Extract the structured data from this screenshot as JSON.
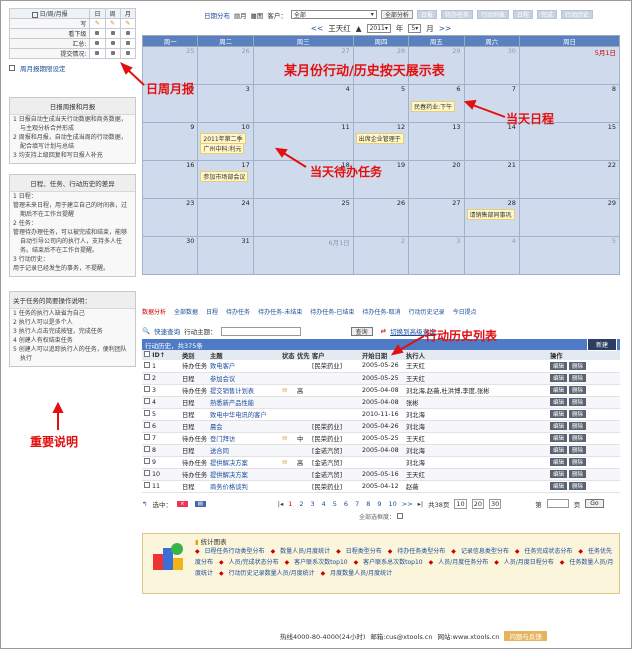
{
  "left_panel": {
    "grid_headers": [
      "日/周/月报",
      "日",
      "周",
      "月"
    ],
    "grid_rows": [
      "写",
      "看下级",
      "汇总:",
      "提交情况:"
    ],
    "setting_link": "周月报期限设定",
    "box1": {
      "title": "日报周报和月报",
      "items": [
        "1 日报自动生成当天行动数据和商务数据，与主观分析合并形成",
        "2 周报和月报，自动生成当周的行动数据，配合填写计划与总结",
        "3 均支持上级回复和写日报人补充"
      ]
    },
    "box2": {
      "title": "日程、任务、行动历史的差异",
      "items": [
        "1 日程：",
        "管理未来日程，用于建立自己的时间表，过期后不在工作台提醒",
        "2 任务：",
        "管理待办理任务，可以被完成和结束，能够自动引导公司内的执行人，支持多人任务。结束后不在工作台提醒。",
        "3 行动历史：",
        "用于记录已经发生的事务，不提醒。"
      ]
    },
    "box3": {
      "title": "关于任务的简要操作说明：",
      "items": [
        "1 任务的执行人缺省为自己",
        "2 执行人可以是多个人",
        "3 执行人点击完成按钮，完成任务",
        "4 创建人有权结束任务",
        "5 创建人可以追踪执行人的任务，便利团队执行"
      ]
    }
  },
  "top_toolbar": {
    "view_label": "日期分布",
    "view_month": "月",
    "view_grid": "图",
    "customer_label": "客户：",
    "customer_select": "全部",
    "btn_all": "全部分析",
    "btn_disabled": [
      "日报",
      "待办任务",
      "行动列表",
      "日程",
      "完成",
      "行动历史"
    ]
  },
  "calendar": {
    "prev": "<<",
    "owner": "王天红",
    "year": "2011",
    "year_suffix": "年",
    "month": "5",
    "month_suffix": "月",
    "next": ">>",
    "weekdays": [
      "周一",
      "周二",
      "周三",
      "周四",
      "周五",
      "周六",
      "周日"
    ],
    "weeks": [
      [
        "25",
        "26",
        "27",
        "28",
        "29",
        "30",
        "5月1日"
      ],
      [
        "2",
        "3",
        "4",
        "5",
        "6",
        "7",
        "8"
      ],
      [
        "9",
        "10",
        "11",
        "12",
        "13",
        "14",
        "15"
      ],
      [
        "16",
        "17",
        "18",
        "19",
        "20",
        "21",
        "22"
      ],
      [
        "23",
        "24",
        "25",
        "26",
        "27",
        "28",
        "29"
      ],
      [
        "30",
        "31",
        "6月1日",
        "2",
        "3",
        "4",
        "5"
      ]
    ],
    "events": {
      "e1": "民春药业:下午",
      "e2": "2011年第二季",
      "e3": "广州中科:利元",
      "e4": "出席企业管理于",
      "e5": "参加市场部会议",
      "e6": "请销售部同事巩"
    }
  },
  "annotations": {
    "a1": "某月份行动/历史按天展示表",
    "a2": "日周月报",
    "a3": "当天日程",
    "a4": "当天待办任务",
    "a5": "行动历史列表",
    "a6": "重要说明"
  },
  "tabs": [
    "数据分析",
    "全部数据",
    "日程",
    "待办任务",
    "待办任务-未结束",
    "待办任务-已结束",
    "待办任务-取消",
    "行动历史记录",
    "今日提点"
  ],
  "quick_search": {
    "label": "快速查询",
    "sub_label": "行动主题：",
    "btn": "查询",
    "advanced": "切换到高级查询"
  },
  "list": {
    "header_title": "行动历史，共375条",
    "new_btn": "新建",
    "columns": [
      "ID↑",
      "类别",
      "主题",
      "状态",
      "优先",
      "客户",
      "开始日期",
      "执行人",
      "操作"
    ],
    "rows": [
      {
        "id": "1",
        "type": "待办任务",
        "subject": "致电客户",
        "state": "",
        "pri": "",
        "customer": "[民荣药业]",
        "date": "2005-05-26",
        "exec": "王天红"
      },
      {
        "id": "2",
        "type": "日程",
        "subject": "参加会议",
        "state": "",
        "pri": "",
        "customer": "",
        "date": "2005-05-25",
        "exec": "王天红"
      },
      {
        "id": "3",
        "type": "待办任务",
        "subject": "提交销售计划表",
        "state": "",
        "pri": "高",
        "customer": "",
        "date": "2005-04-08",
        "exec": "刘北海,赵薇,杜洪博,李度,张彬"
      },
      {
        "id": "4",
        "type": "日程",
        "subject": "熟悉新产品性能",
        "state": "",
        "pri": "",
        "customer": "",
        "date": "2005-04-08",
        "exec": "张彬"
      },
      {
        "id": "5",
        "type": "日程",
        "subject": "致电中华电讯的客户",
        "state": "",
        "pri": "",
        "customer": "",
        "date": "2010-11-16",
        "exec": "刘北海"
      },
      {
        "id": "6",
        "type": "日程",
        "subject": "晨会",
        "state": "",
        "pri": "",
        "customer": "[民荣药业]",
        "date": "2005-04-26",
        "exec": "刘北海"
      },
      {
        "id": "7",
        "type": "待办任务",
        "subject": "登门拜访",
        "state": "",
        "pri": "中",
        "customer": "[民荣药业]",
        "date": "2005-05-25",
        "exec": "王天红"
      },
      {
        "id": "8",
        "type": "日程",
        "subject": "送合同",
        "state": "",
        "pri": "",
        "customer": "[金诺汽贸]",
        "date": "2005-04-08",
        "exec": "刘北海"
      },
      {
        "id": "9",
        "type": "待办任务",
        "subject": "提供解决方案",
        "state": "",
        "pri": "高",
        "customer": "[金诺汽贸]",
        "date": "",
        "exec": "刘北海"
      },
      {
        "id": "10",
        "type": "待办任务",
        "subject": "提供解决方案",
        "state": "",
        "pri": "",
        "customer": "[金诺汽贸]",
        "date": "2005-05-16",
        "exec": "王天红"
      },
      {
        "id": "11",
        "type": "日程",
        "subject": "商务价格谈判",
        "state": "",
        "pri": "",
        "customer": "[民荣药业]",
        "date": "2005-04-12",
        "exec": "赵薇"
      }
    ],
    "edit": "编辑",
    "del": "删除"
  },
  "pager": {
    "selected": "选中：",
    "pages": [
      "1",
      "2",
      "3",
      "4",
      "5",
      "6",
      "7",
      "8",
      "9",
      "10"
    ],
    "more": ">>",
    "total": "共38页",
    "sizes": [
      "10",
      "20",
      "30"
    ],
    "page_label": "第",
    "page_unit": "页",
    "go": "Go",
    "select_all": "全部选框度："
  },
  "stats": {
    "title": "统计图表",
    "links": [
      "日程任务行动类型分布",
      "数量人员/月度统计",
      "日程类型分布",
      "待办任务类型分布",
      "记录信息类型分布",
      "任务完成状态分布",
      "任务优先度分布",
      "人员/完成状态分布",
      "客户联系次数top10",
      "客户联系总次数top10",
      "人员/月度任务分布",
      "人员/月度日程分布",
      "任务数量人员/月度统计",
      "行动历史记录数量人员/月度统计",
      "月度数量人员/月度统计"
    ]
  },
  "footer": {
    "hotline": "热线4000-80-4000(24小时)",
    "email_label": "邮箱:cus@xtools.cn",
    "site": "网站:www.xtools.cn",
    "btn": "问题与反馈"
  }
}
